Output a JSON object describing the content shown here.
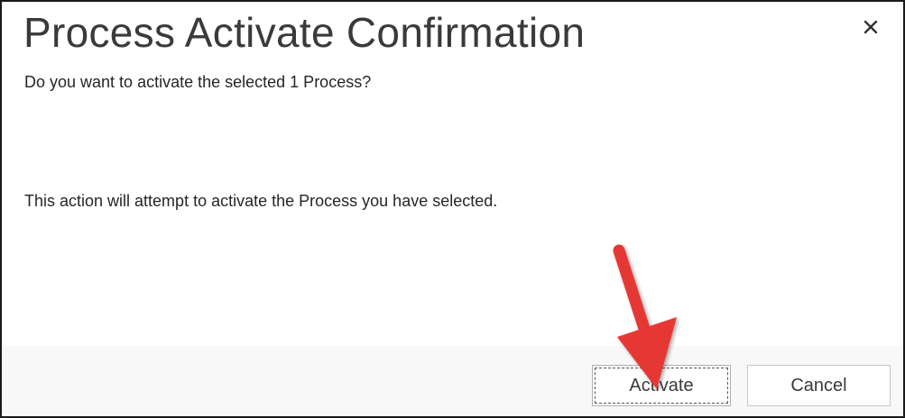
{
  "dialog": {
    "title": "Process Activate Confirmation",
    "question": "Do you want to activate the selected 1 Process?",
    "description": "This action will attempt to activate the Process you have selected.",
    "close_icon": "close-icon",
    "buttons": {
      "activate_label": "Activate",
      "cancel_label": "Cancel"
    }
  },
  "annotation": {
    "arrow_icon": "red-arrow-icon",
    "arrow_color": "#e53935"
  },
  "colors": {
    "footer_background": "#f8f8f8",
    "border": "#1a1a1a",
    "title_text": "#3a3a3a"
  }
}
